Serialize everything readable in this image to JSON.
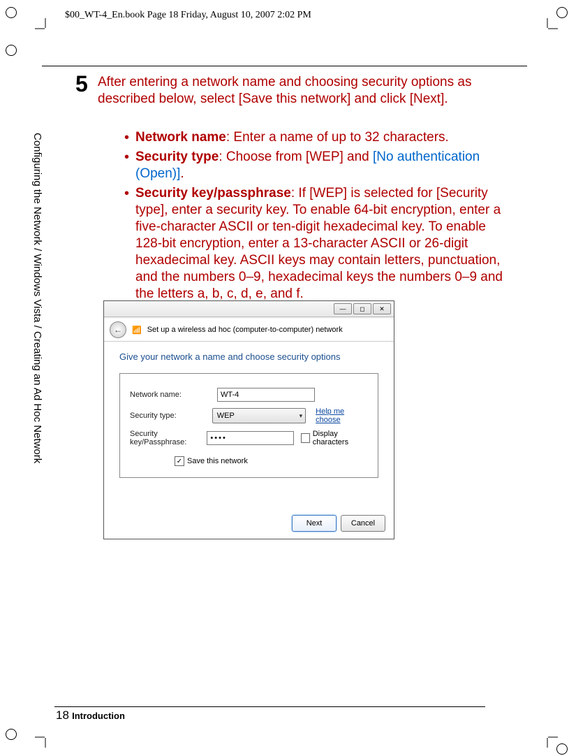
{
  "header_print": "$00_WT-4_En.book  Page 18  Friday, August 10, 2007  2:02 PM",
  "step_number": "5",
  "step_text_1": "After entering a network name and choosing security options as described below, select [Save this network] and click [Next].",
  "bullet_net_name_label": "Network name",
  "bullet_net_name_text": ": Enter a name of up to 32 characters.",
  "bullet_sectype_label": "Security type",
  "bullet_sectype_text_1": ": Choose from [WEP] and ",
  "bullet_sectype_link": "[No authentication (Open)]",
  "bullet_sectype_dot": ".",
  "bullet_seckey_label": "Security key/passphrase",
  "bullet_seckey_text": ": If [WEP] is selected for [Security type], enter a security key.  To enable 64-bit encryption, enter a five-character ASCII or ten-digit hexadecimal key.  To enable 128-bit encryption, enter a 13-character ASCII or 26-digit hexadecimal key.  ASCII keys may contain letters, punctuation, and the numbers 0–9, hexadecimal keys the numbers 0–9 and the letters a, b, c, d, e, and f.",
  "vertical_text": "Configuring the Network / Windows Vista / Creating an Ad Hoc Network",
  "page_number": "18",
  "footer_section": "Introduction",
  "window": {
    "wizard_title": "Set up a wireless ad hoc (computer-to-computer) network",
    "subtitle": "Give your network a name and choose security options",
    "label_network_name": "Network name:",
    "value_network_name": "WT-4",
    "label_security_type": "Security type:",
    "value_security_type": "WEP",
    "help_link": "Help me choose",
    "label_passphrase": "Security key/Passphrase:",
    "value_passphrase": "••••",
    "display_chars": "Display characters",
    "save_network": "Save this network",
    "btn_next": "Next",
    "btn_cancel": "Cancel",
    "min": "—",
    "max": "◻",
    "close": "✕",
    "back": "←",
    "check": "✓"
  },
  "chart_data": null
}
